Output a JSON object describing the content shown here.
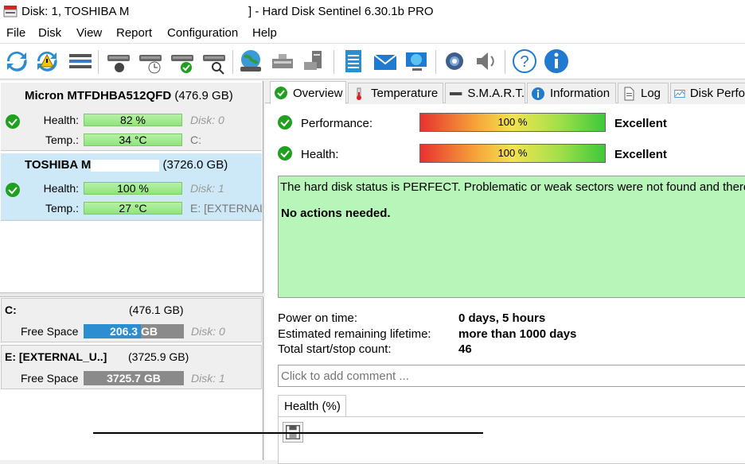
{
  "window": {
    "title_left": "Disk: 1, TOSHIBA M",
    "title_right": "]  -  Hard Disk Sentinel 6.30.1b PRO"
  },
  "menu": [
    "File",
    "Disk",
    "View",
    "Report",
    "Configuration",
    "Help"
  ],
  "toolbar": {
    "buttons": [
      "refresh-icon",
      "refresh-warning-icon",
      "disk-list-icon",
      "disk-tool-icon",
      "disk-clock-icon",
      "disk-check-icon",
      "disk-search-icon",
      "globe-icon",
      "network-disk-icon",
      "server-disk-icon",
      "notes-icon",
      "mail-icon",
      "web-icon",
      "gear-icon",
      "speaker-icon",
      "help-icon",
      "info-icon"
    ]
  },
  "disks": [
    {
      "model": "Micron MTFDHBA512QFD",
      "size": "(476.9 GB)",
      "health_label": "Health:",
      "health": "82 %",
      "temp_label": "Temp.:",
      "temp": "34 °C",
      "disk_ref": "Disk: 0",
      "volume_ref": "C:"
    },
    {
      "model": "TOSHIBA M",
      "size": "(3726.0 GB)",
      "health_label": "Health:",
      "health": "100 %",
      "temp_label": "Temp.:",
      "temp": "27 °C",
      "disk_ref": "Disk: 1",
      "volume_ref": "E: [EXTERNAL"
    }
  ],
  "volumes": [
    {
      "name": "C:",
      "size": "(476.1 GB)",
      "free_label": "Free Space",
      "free": "206.3 GB",
      "used_fraction": 0.57,
      "disk_ref": "Disk: 0"
    },
    {
      "name": "E: [EXTERNAL_U..]",
      "size": "(3725.9 GB)",
      "free_label": "Free Space",
      "free": "3725.7 GB",
      "used_fraction": 0.0,
      "disk_ref": "Disk: 1"
    }
  ],
  "tabs": [
    "Overview",
    "Temperature",
    "S.M.A.R.T.",
    "Information",
    "Log",
    "Disk Perfo"
  ],
  "overview": {
    "performance_label": "Performance:",
    "performance_value": "100 %",
    "performance_status": "Excellent",
    "health_label": "Health:",
    "health_value": "100 %",
    "health_status": "Excellent",
    "status_message": "The hard disk status is PERFECT. Problematic or weak sectors were not found and there",
    "action": "No actions needed.",
    "power_on_label": "Power on time:",
    "power_on_value": "0 days, 5 hours",
    "lifetime_label": "Estimated remaining lifetime:",
    "lifetime_value": "more than 1000 days",
    "startstop_label": "Total start/stop count:",
    "startstop_value": "46",
    "comment_placeholder": "Click to add comment ...",
    "health_tab": "Health (%)"
  },
  "colors": {
    "selected_disk_bg": "#cde9f7",
    "healthy_bar": "#9be888",
    "status_ok_bg": "#b8f5b8",
    "free_space_bar": "#2a8ed0"
  }
}
